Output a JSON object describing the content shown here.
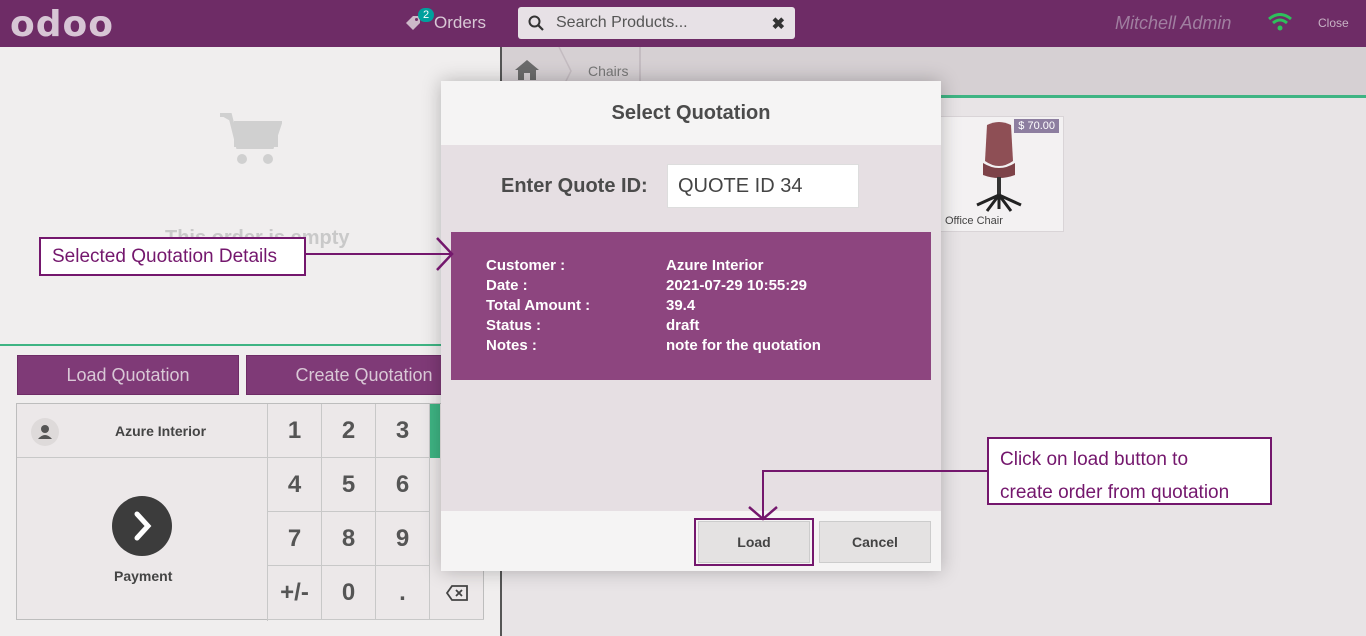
{
  "topbar": {
    "logo": "odoo",
    "orders_label": "Orders",
    "orders_count": "2",
    "search_placeholder": "Search Products...",
    "user": "Mitchell Admin",
    "close_label": "Close",
    "bg_color": "#6e2c66"
  },
  "order": {
    "empty_text": "This order is empty",
    "load_quotation": "Load Quotation",
    "create_quotation": "Create Quotation",
    "customer": "Azure Interior",
    "payment_label": "Payment",
    "keys": [
      "1",
      "2",
      "3",
      "4",
      "5",
      "6",
      "7",
      "8",
      "9",
      "+/-",
      "0",
      "."
    ]
  },
  "products": {
    "breadcrumb_category": "Chairs",
    "items": [
      {
        "name": "Office Chair",
        "price": "$ 70.00"
      }
    ]
  },
  "modal": {
    "title": "Select Quotation",
    "quote_label": "Enter Quote ID:",
    "quote_value": "QUOTE ID 34",
    "details": [
      {
        "label": "Customer :",
        "value": "Azure Interior"
      },
      {
        "label": "Date :",
        "value": "2021-07-29 10:55:29"
      },
      {
        "label": "Total Amount :",
        "value": "39.4"
      },
      {
        "label": "Status :",
        "value": "draft"
      },
      {
        "label": "Notes :",
        "value": "note for the quotation"
      }
    ],
    "load_label": "Load",
    "cancel_label": "Cancel",
    "details_color": "#8d457f"
  },
  "annotations": {
    "left": "Selected Quotation Details",
    "right_line1": "Click on load button to",
    "right_line2": "create order from quotation",
    "color": "#74176d"
  }
}
